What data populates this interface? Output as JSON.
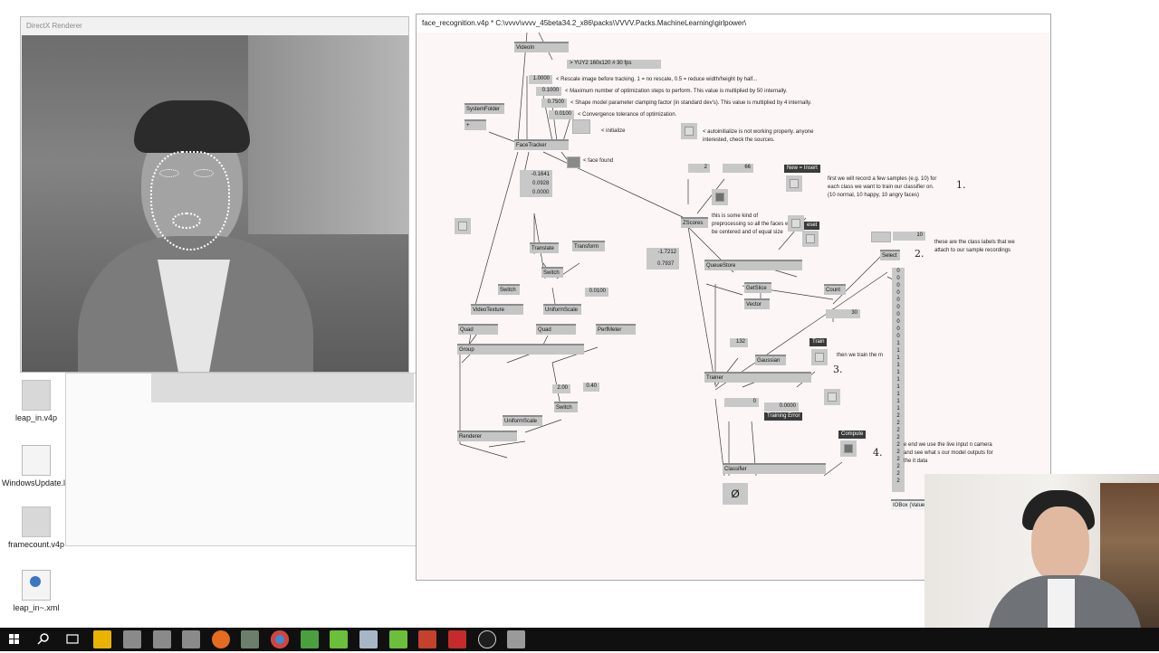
{
  "desktop": {
    "icons": [
      {
        "label": "leap_in.v4p"
      },
      {
        "label": "WindowsUpdate.log"
      },
      {
        "label": "framecount.v4p"
      },
      {
        "label": "leap_in~.xml"
      }
    ]
  },
  "renderer": {
    "title": "DirectX Renderer"
  },
  "patch": {
    "title": "face_recognition.v4p *  C:\\vvvv\\vvvv_45beta34.2_x86\\packs\\VVVV.Packs.MachineLearning\\girlpower\\",
    "nodes": {
      "videoin": "VideoIn",
      "systemfolder": "SystemFolder",
      "plus": "+",
      "facetracker": "FaceTracker",
      "translate": "Translate",
      "transform": "Transform",
      "switch1": "Switch",
      "switch2": "Switch",
      "switch3": "Switch",
      "videotexture": "VideoTexture",
      "uniformscale1": "UniformScale",
      "uniformscale2": "UniformScale",
      "quad1": "Quad",
      "quad2": "Quad",
      "perfmeter": "PerfMeter",
      "group": "Group",
      "renderer": "Renderer",
      "zscores": "ZScores",
      "queuestore": "QueueStore",
      "getslice": "GetSlice",
      "vector": "Vector",
      "count": "Count",
      "select": "Select",
      "gaussian": "Gaussian",
      "trainer": "Trainer",
      "classifier": "Classifier",
      "iobox_value": "IOBox (Value"
    },
    "values": {
      "format": "> YUY2 160x120 # 30 fps",
      "rescale": "1.0000",
      "maxopt": "0.1000",
      "clamp": "0.7500",
      "conv": "0.0100",
      "v1": "-0.1641",
      "v2": "0.0928",
      "v3": "0.0000",
      "v4": "-1.7212",
      "v5": "0.7937",
      "scale1": "0.0100",
      "n2": "2",
      "n66": "66",
      "n10": "10",
      "n30": "30",
      "n132": "132",
      "n0": "0",
      "s200": "2.00",
      "s040": "0.40",
      "training_error_value": "0.0000",
      "empty_set": "Ø"
    },
    "notes": {
      "rescale": "< Rescale image before tracking. 1 = no rescale, 0.5 = reduce width/height by half...",
      "maxopt": "< Maximum number of optimization steps to perform. This value is multiplied by 50 internally.",
      "clamp": "< Shape model parameter clamping factor (in standard dev's). This value is multiplied by 4 internally.",
      "conv": "< Convergence tolerance of optimization.",
      "initialize": "< initialize",
      "autoinit": "< autoinitialize is not working properly. anyone interested, check the sources.",
      "face_found": "< face found",
      "record": "first we will record a few samples (e.g. 10) for each class we want to train our classifier on. (10 normal, 10 happy, 10 angry faces)",
      "preprocess": "this is some kind of preprocessing so all the faces will be centered and of equal size",
      "labels": "these are the class labels that we attach to our sample recordings",
      "train": "then we train the m",
      "live": "e end we use the live input n camera and see what s our model outputs for the it data"
    },
    "buttons": {
      "new_insert": "New = Insert",
      "reset": "eset",
      "train": "Train",
      "compute": "Compute",
      "training_error": "Training Error"
    },
    "steps": [
      "1.",
      "2.",
      "3.",
      "4."
    ],
    "class_labels": [
      "0",
      "0",
      "0",
      "0",
      "0",
      "0",
      "0",
      "0",
      "0",
      "0",
      "1",
      "1",
      "1",
      "1",
      "1",
      "1",
      "1",
      "1",
      "1",
      "1",
      "2",
      "2",
      "2",
      "2",
      "2",
      "2",
      "2",
      "2",
      "2",
      "2"
    ]
  },
  "colors": {
    "patch_bg": "#fdf6f6",
    "node_bg": "#c5c5c5",
    "taskbar": "#101010",
    "accent_powerpoint": "#c4412b",
    "accent_green": "#4aa03f"
  },
  "taskbar": {
    "buttons": [
      "start-icon",
      "search-icon",
      "task-view-icon",
      "file-explorer-icon",
      "app-icon",
      "app-icon",
      "app-icon",
      "firefox-icon",
      "tool-icon",
      "chrome-icon",
      "app-icon",
      "app-icon",
      "app-icon",
      "app-icon",
      "powerpoint-icon",
      "video-icon",
      "vvvv-icon",
      "app-icon"
    ]
  }
}
